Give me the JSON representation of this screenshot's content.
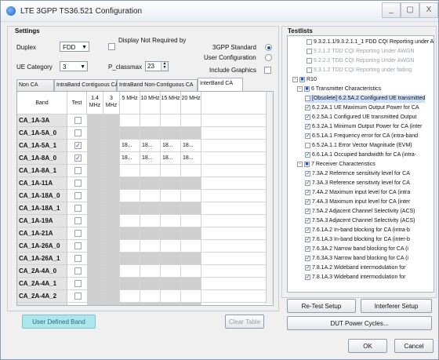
{
  "window": {
    "title": "LTE 3GPP TS36.521 Configuration",
    "minimize": "_",
    "maximize": "▢",
    "close": "X"
  },
  "settings": {
    "title": "Settings",
    "duplex_label": "Duplex",
    "duplex_value": "FDD",
    "display_not_required_label": "Display Not Required by",
    "ue_category_label": "UE Category",
    "ue_category_value": "3",
    "p_classmax_label": "P_classmax",
    "p_classmax_value": "23",
    "standard_label": "3GPP Standard",
    "user_config_label": "User Configuration",
    "include_graphics_label": "Include Graphics"
  },
  "tabs": [
    "Non CA",
    "IntraBand Contiguous CA",
    "IntraBand Non-Contiguous CA",
    "InterBand CA"
  ],
  "table": {
    "headers": [
      "Band",
      "Test",
      "1.4 MHz",
      "3 MHz",
      "5 MHz",
      "10 MHz",
      "15 MHz",
      "20 MHz"
    ],
    "rows": [
      {
        "band": "CA_1A-3A",
        "test": "",
        "vals": [
          "",
          "",
          "",
          "",
          "",
          ""
        ]
      },
      {
        "band": "CA_1A-5A_0",
        "test": "",
        "vals": [
          "",
          "",
          "",
          "",
          "",
          ""
        ]
      },
      {
        "band": "CA_1A-5A_1",
        "test": "✓",
        "vals": [
          "",
          "",
          "18...",
          "18...",
          "18...",
          "18..."
        ]
      },
      {
        "band": "CA_1A-8A_0",
        "test": "✓",
        "vals": [
          "",
          "",
          "18...",
          "18...",
          "18...",
          "18..."
        ]
      },
      {
        "band": "CA_1A-8A_1",
        "test": "",
        "vals": [
          "",
          "",
          "",
          "",
          "",
          ""
        ]
      },
      {
        "band": "CA_1A-11A",
        "test": "",
        "vals": [
          "",
          "",
          "",
          "",
          "",
          ""
        ]
      },
      {
        "band": "CA_1A-18A_0",
        "test": "",
        "vals": [
          "",
          "",
          "",
          "",
          "",
          ""
        ]
      },
      {
        "band": "CA_1A-18A_1",
        "test": "",
        "vals": [
          "",
          "",
          "",
          "",
          "",
          ""
        ]
      },
      {
        "band": "CA_1A-19A",
        "test": "",
        "vals": [
          "",
          "",
          "",
          "",
          "",
          ""
        ]
      },
      {
        "band": "CA_1A-21A",
        "test": "",
        "vals": [
          "",
          "",
          "",
          "",
          "",
          ""
        ]
      },
      {
        "band": "CA_1A-26A_0",
        "test": "",
        "vals": [
          "",
          "",
          "",
          "",
          "",
          ""
        ]
      },
      {
        "band": "CA_1A-26A_1",
        "test": "",
        "vals": [
          "",
          "",
          "",
          "",
          "",
          ""
        ]
      },
      {
        "band": "CA_2A-4A_0",
        "test": "",
        "vals": [
          "",
          "",
          "",
          "",
          "",
          ""
        ]
      },
      {
        "band": "CA_2A-4A_1",
        "test": "",
        "vals": [
          "",
          "",
          "",
          "",
          "",
          ""
        ]
      },
      {
        "band": "CA_2A-4A_2",
        "test": "",
        "vals": [
          "",
          "",
          "",
          "",
          "",
          ""
        ]
      },
      {
        "band": "CA_2A-5A",
        "test": "",
        "vals": [
          "",
          "",
          "",
          "",
          "",
          ""
        ]
      }
    ]
  },
  "buttons": {
    "user_defined_band": "User Defined Band",
    "clear_table": "Clear Table",
    "retest_setup": "Re-Test Setup",
    "interferer_setup": "Interferer Setup",
    "dut_power_cycles": "DUT Power Cycles...",
    "ok": "OK",
    "cancel": "Cancel"
  },
  "testlists": {
    "title": "Testlists",
    "items": [
      {
        "text": "9.3.2.1.1/9.3.2.1.1_1 FDD CQI Reporting under AWGN",
        "check": "",
        "dim": false
      },
      {
        "text": "9.2.1.2 TDD CQI Reporting Under AWGN",
        "check": "",
        "dim": true
      },
      {
        "text": "9.2.2.2 TDD CQI Reporting Under AWGN",
        "check": "",
        "dim": true
      },
      {
        "text": "9.3.1.2 TDD CQI Reporting under fading",
        "check": "",
        "dim": true
      },
      {
        "text": "R10",
        "check": "■",
        "dim": false
      },
      {
        "text": "6 Transmitter Characteristics",
        "check": "■",
        "dim": false
      },
      {
        "text": "[Obsolete] 6.2.5A.2 Configured UE transmitted",
        "check": "",
        "dim": false
      },
      {
        "text": "6.2.2A.1 UE Maximum Output Power for CA",
        "check": "✓",
        "dim": false
      },
      {
        "text": "6.2.5A.1 Configured UE transmitted Output",
        "check": "✓",
        "dim": false
      },
      {
        "text": "6.3.2A.1 Minimum Output Power for CA (inter",
        "check": "✓",
        "dim": false
      },
      {
        "text": "6.5.1A.1 Frequency error for CA (intra-band",
        "check": "✓",
        "dim": false
      },
      {
        "text": "6.5.2A.1.1 Error Vector Magnitude (EVM)",
        "check": "",
        "dim": false
      },
      {
        "text": "6.6.1A.1 Occupied bandwidth for CA (intra-",
        "check": "✓",
        "dim": false
      },
      {
        "text": "7 Receiver Characteristics",
        "check": "■",
        "dim": false
      },
      {
        "text": "7.3A.2 Reference sensitivity level for CA",
        "check": "✓",
        "dim": false
      },
      {
        "text": "7.3A.3 Reference sensitivity level for CA",
        "check": "✓",
        "dim": false
      },
      {
        "text": "7.4A.2 Maximum input level for CA (intra",
        "check": "✓",
        "dim": false
      },
      {
        "text": "7.4A.3 Maximum input level for CA (inter",
        "check": "✓",
        "dim": false
      },
      {
        "text": "7.5A.2 Adjacent Channel Selectivity (ACS)",
        "check": "✓",
        "dim": false
      },
      {
        "text": "7.5A.3 Adjacent Channel Selectivity (ACS)",
        "check": "✓",
        "dim": false
      },
      {
        "text": "7.6.1A.2 In-band blocking for CA (intra-b",
        "check": "✓",
        "dim": false
      },
      {
        "text": "7.6.1A.3 In-band blocking for CA (inter-b",
        "check": "✓",
        "dim": false
      },
      {
        "text": "7.6.3A.2 Narrow band blocking for CA (i",
        "check": "✓",
        "dim": false
      },
      {
        "text": "7.6.3A.3 Narrow band blocking for CA (i",
        "check": "✓",
        "dim": false
      },
      {
        "text": "7.8.1A.2 Wideband intermodulation for",
        "check": "✓",
        "dim": false
      },
      {
        "text": "7.8.1A.3 Wideband intermodulation for",
        "check": "✓",
        "dim": false
      }
    ]
  }
}
